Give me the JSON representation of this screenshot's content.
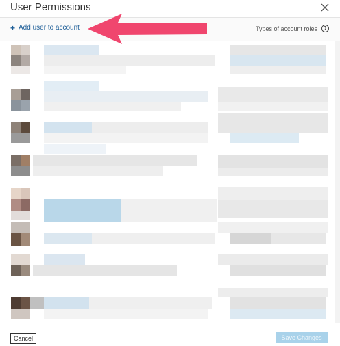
{
  "dialog": {
    "title": "User Permissions",
    "close_icon": "close-icon"
  },
  "toolbar": {
    "add_user_label": "Add user to account",
    "add_icon": "plus-icon",
    "roles_label": "Types of account roles",
    "help_icon": "question-circle-icon"
  },
  "footer": {
    "cancel_label": "Cancel",
    "save_label": "Save Changes"
  },
  "annotation": {
    "arrow_color": "#f0466e"
  },
  "colors": {
    "link": "#1f5f98",
    "save_disabled": "#a9d2ea"
  }
}
